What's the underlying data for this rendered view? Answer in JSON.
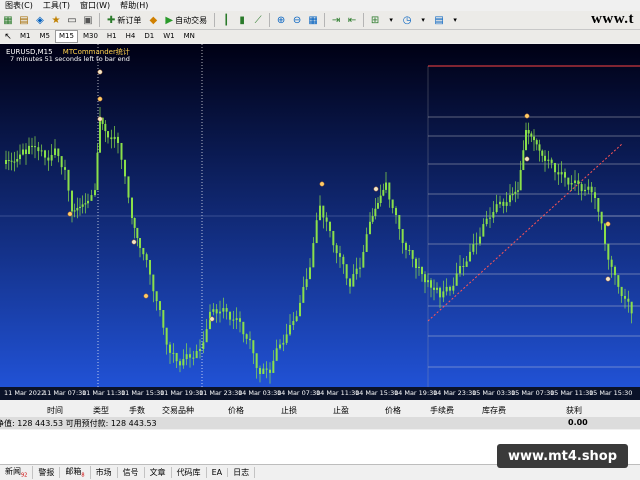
{
  "menu": [
    "图表(C)",
    "工具(T)",
    "窗口(W)",
    "帮助(H)"
  ],
  "toolbar": {
    "new_order": "新订单",
    "auto_trade": "自动交易",
    "icons": [
      "new-chart-icon",
      "profiles-icon",
      "market-watch-icon",
      "navigator-icon",
      "terminal-icon",
      "strategy-tester-icon",
      "bar-chart-icon",
      "candle-chart-icon",
      "line-chart-icon",
      "zoom-in-icon",
      "zoom-out-icon",
      "tile-icon",
      "scroll-icon",
      "autoscroll-icon",
      "indicators-icon",
      "periods-icon",
      "templates-icon"
    ]
  },
  "logo": "www.t",
  "timeframes": [
    "M1",
    "M5",
    "M15",
    "M30",
    "H1",
    "H4",
    "D1",
    "W1",
    "MN"
  ],
  "active_timeframe": "M15",
  "chart": {
    "symbol": "EURUSD,M15",
    "ea_name": "MTCommander统计",
    "countdown": "7 minutes 51 seconds left to bar end",
    "time_labels": [
      "11 Mar 2022",
      "11 Mar 07:30",
      "11 Mar 11:30",
      "11 Mar 15:30",
      "11 Mar 19:30",
      "11 Mar 23:30",
      "14 Mar 03:30",
      "14 Mar 07:30",
      "14 Mar 11:30",
      "14 Mar 15:30",
      "14 Mar 19:30",
      "14 Mar 23:30",
      "15 Mar 03:30",
      "15 Mar 07:30",
      "15 Mar 11:30",
      "15 Mar 15:30"
    ],
    "bg_top": "#000014",
    "bg_bottom": "#2255dd",
    "candle_color": "#8ae04a"
  },
  "terminal": {
    "columns": [
      "时间",
      "类型",
      "手数",
      "交易品种",
      "价格",
      "止损",
      "止盈",
      "价格",
      "手续费",
      "库存费",
      "获利"
    ],
    "balance_text": "净值: 128 443.53  可用预付款: 128 443.53",
    "profit_total": "0.00"
  },
  "bottom_tabs": [
    {
      "label": "新闻",
      "badge": "92"
    },
    {
      "label": "警报",
      "badge": ""
    },
    {
      "label": "邮箱",
      "badge": "8"
    },
    {
      "label": "市场",
      "badge": ""
    },
    {
      "label": "信号",
      "badge": ""
    },
    {
      "label": "文章",
      "badge": ""
    },
    {
      "label": "代码库",
      "badge": ""
    },
    {
      "label": "EA",
      "badge": ""
    },
    {
      "label": "日志",
      "badge": ""
    }
  ],
  "watermark": "www.mt4.shop"
}
